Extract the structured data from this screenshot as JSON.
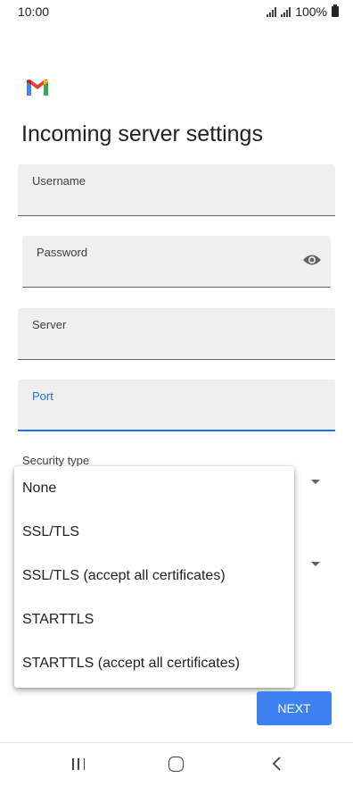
{
  "status_bar": {
    "time": "10:00",
    "battery_text": "100%"
  },
  "app": {
    "logo_icon": "gmail-logo"
  },
  "page": {
    "title": "Incoming server settings"
  },
  "fields": {
    "username": {
      "label": "Username",
      "value": ""
    },
    "password": {
      "label": "Password",
      "value": "",
      "icon": "eye-icon"
    },
    "server": {
      "label": "Server",
      "value": ""
    },
    "port": {
      "label": "Port",
      "value": "",
      "focused": true
    }
  },
  "security_type": {
    "label": "Security type",
    "options": [
      "None",
      "SSL/TLS",
      "SSL/TLS (accept all certificates)",
      "STARTTLS",
      "STARTTLS (accept all certificates)"
    ]
  },
  "actions": {
    "next_label": "NEXT"
  },
  "colors": {
    "accent": "#1a73e8",
    "button": "#3d82f0",
    "field_bg": "#efefef"
  }
}
